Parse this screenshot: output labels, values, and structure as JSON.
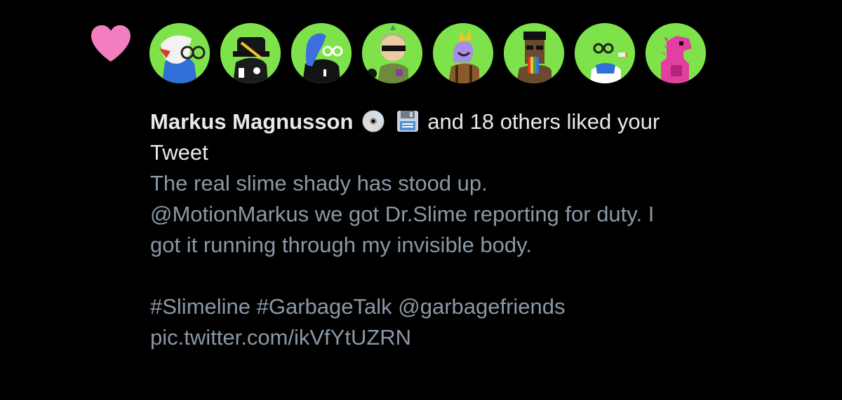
{
  "notification": {
    "type_icon": "heart-icon",
    "heart_color": "#f47fc0",
    "avatars": [
      {
        "name": "avatar-1",
        "icon": "pixel-character-glasses-cap"
      },
      {
        "name": "avatar-2",
        "icon": "pixel-character-black-hat"
      },
      {
        "name": "avatar-3",
        "icon": "pixel-character-blue-head"
      },
      {
        "name": "avatar-4",
        "icon": "pixel-character-sunglasses-cat"
      },
      {
        "name": "avatar-5",
        "icon": "pixel-character-crown"
      },
      {
        "name": "avatar-6",
        "icon": "pixel-character-rainbow-beard"
      },
      {
        "name": "avatar-7",
        "icon": "pixel-character-glasses-shirt"
      },
      {
        "name": "avatar-8",
        "icon": "pixel-dinosaur-pink"
      }
    ],
    "avatar_bg_color": "#7ee34a",
    "liker_name": "Markus Magnusson",
    "liker_emojis": [
      "cd-disc-icon",
      "floppy-disk-icon"
    ],
    "liked_suffix": "and 18 others liked your",
    "liked_object": "Tweet",
    "tweet_lines": {
      "line1": "The real slime shady has stood up.",
      "line2": "@MotionMarkus we got Dr.Slime reporting for duty. I",
      "line3": "got it running through my invisible body.",
      "line4": "#Slimeline #GarbageTalk @garbagefriends",
      "line5": "pic.twitter.com/ikVfYtUZRN"
    },
    "text_color_primary": "#e7e9ea",
    "text_color_secondary": "#8b98a5"
  }
}
